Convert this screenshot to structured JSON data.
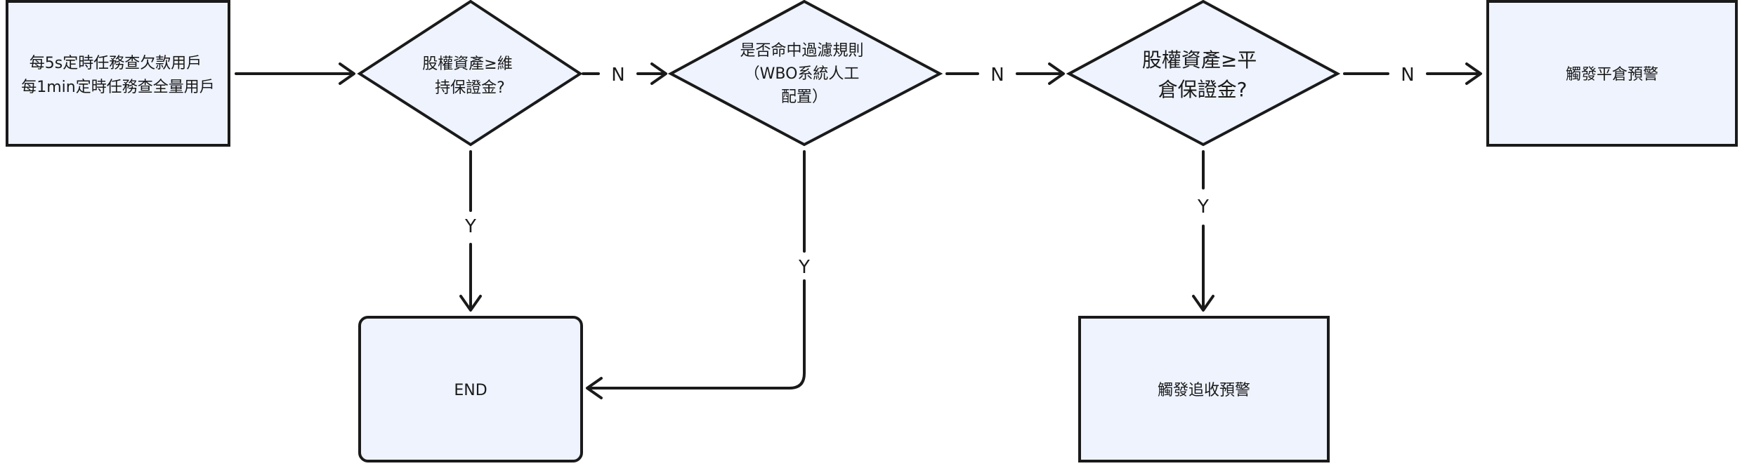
{
  "nodes": {
    "start": {
      "lines": [
        "每5s定時任務查欠款用戶",
        "每1min定時任務查全量用戶"
      ]
    },
    "check_maintenance": {
      "lines": [
        "股權資產≥維",
        "持保證金?"
      ]
    },
    "check_filter": {
      "lines": [
        "是否命中過濾規則",
        "（WBO系統人工",
        "配置）"
      ]
    },
    "check_liquidation": {
      "lines": [
        "股權資產≥平",
        "倉保證金?"
      ]
    },
    "liquidation_alert": {
      "lines": [
        "觸發平倉預警"
      ]
    },
    "end": {
      "lines": [
        "END"
      ]
    },
    "margin_call_alert": {
      "lines": [
        "觸發追收預警"
      ]
    }
  },
  "edges": {
    "maintenance_no": "N",
    "maintenance_yes": "Y",
    "filter_no": "N",
    "filter_yes": "Y",
    "liquidation_no": "N",
    "liquidation_yes": "Y"
  },
  "colors": {
    "node_fill": "#eef3fd",
    "stroke": "#1a1a1a"
  }
}
